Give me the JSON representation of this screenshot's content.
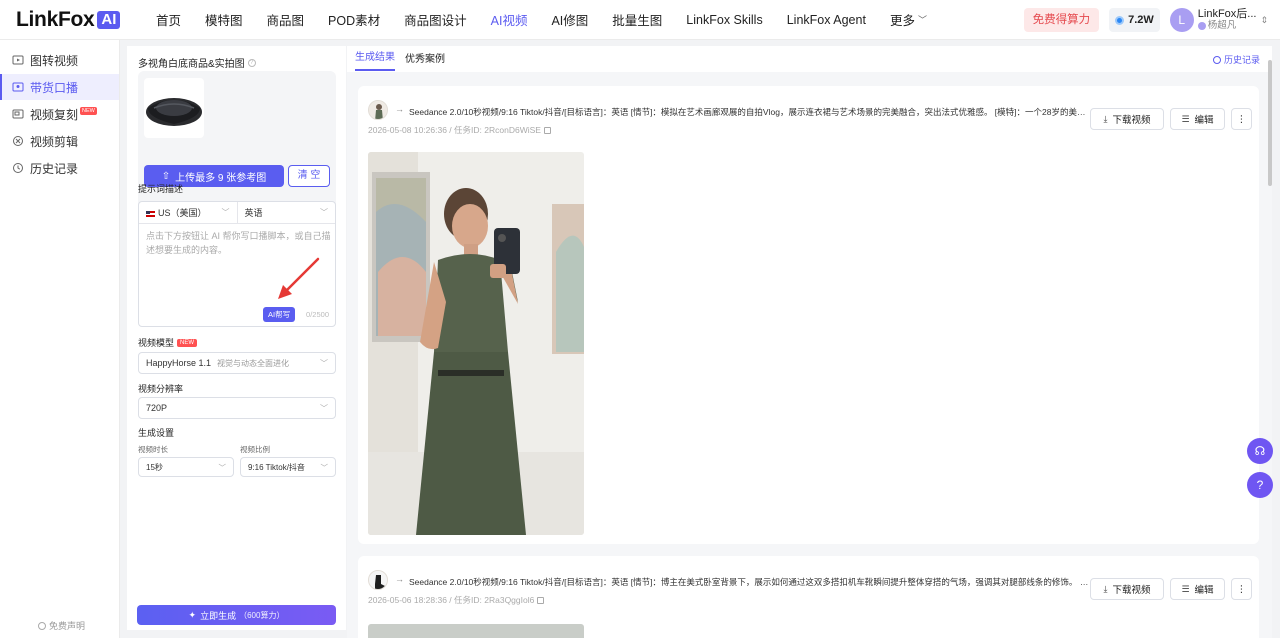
{
  "brand": {
    "name": "LinkFox",
    "badge": "AI"
  },
  "nav": {
    "items": [
      "首页",
      "模特图",
      "商品图",
      "POD素材",
      "商品图设计",
      "AI视频",
      "AI修图",
      "批量生图",
      "LinkFox Skills",
      "LinkFox Agent"
    ],
    "active": "AI视频",
    "more": "更多"
  },
  "header_right": {
    "free_btn": "免费得算力",
    "credits": "7.2W",
    "user_name": "LinkFox后...",
    "user_sub": "杨超凡",
    "avatar_letter": "L"
  },
  "sidebar": {
    "items": [
      {
        "label": "图转视频",
        "icon": "image-video-icon"
      },
      {
        "label": "带货口播",
        "icon": "presenter-icon",
        "active": true
      },
      {
        "label": "视频复刻",
        "icon": "video-copy-icon",
        "badge": "NEW"
      },
      {
        "label": "视频剪辑",
        "icon": "scissors-icon"
      },
      {
        "label": "历史记录",
        "icon": "history-icon"
      }
    ],
    "footer": "免费声明"
  },
  "config": {
    "product_title": "多视角白底商品&实拍图",
    "upload_btn": "上传最多 9 张参考图",
    "clear_btn": "清 空",
    "prompt_label": "提示词描述",
    "region": "US（美国）",
    "language": "英语",
    "prompt_placeholder": "点击下方按钮让 AI 帮你写口播脚本，或自己描述想要生成的内容。",
    "ai_write": "AI帮写",
    "counter": "0/2500",
    "model_label": "视频模型",
    "model_badge": "NEW",
    "model_value": "HappyHorse 1.1",
    "model_hint": "视觉与动态全面进化",
    "resolution_label": "视频分辨率",
    "resolution_value": "720P",
    "gen_settings_label": "生成设置",
    "duration_label": "视频时长",
    "duration_value": "15秒",
    "ratio_label": "视频比例",
    "ratio_value": "9:16 Tiktok/抖音",
    "generate_btn": "立即生成",
    "generate_cost": "（600算力）"
  },
  "results": {
    "tabs": [
      "生成结果",
      "优秀案例"
    ],
    "active_tab": "生成结果",
    "history": "历史记录",
    "cards": [
      {
        "prompt": "Seedance 2.0/10秒视频/9:16 Tiktok/抖音/[目标语言]：英语 [情节]：模拟在艺术画廊观展的自拍Vlog，展示连衣裙与艺术场景的完美融合，突出法式优雅感。 [模特]：一个28岁的美国白...",
        "time": "2026-05-08 10:26:36",
        "task": "任务ID: 2RconD6WiSE",
        "download": "下载视频",
        "edit": "编辑"
      },
      {
        "prompt": "Seedance 2.0/10秒视频/9:16 Tiktok/抖音/[目标语言]：英语 [情节]：博主在美式卧室背景下，展示如何通过这双多搭扣机车靴瞬间提升整体穿搭的气场，强调其对腿部线条的修饰。 [模特]：...",
        "time": "2026-05-06 18:28:36",
        "task": "任务ID: 2Ra3QggIol6",
        "download": "下载视频",
        "edit": "编辑"
      }
    ]
  },
  "colors": {
    "accent": "#5b5bf0",
    "danger": "#e5484d",
    "float": "#6f56f2"
  }
}
